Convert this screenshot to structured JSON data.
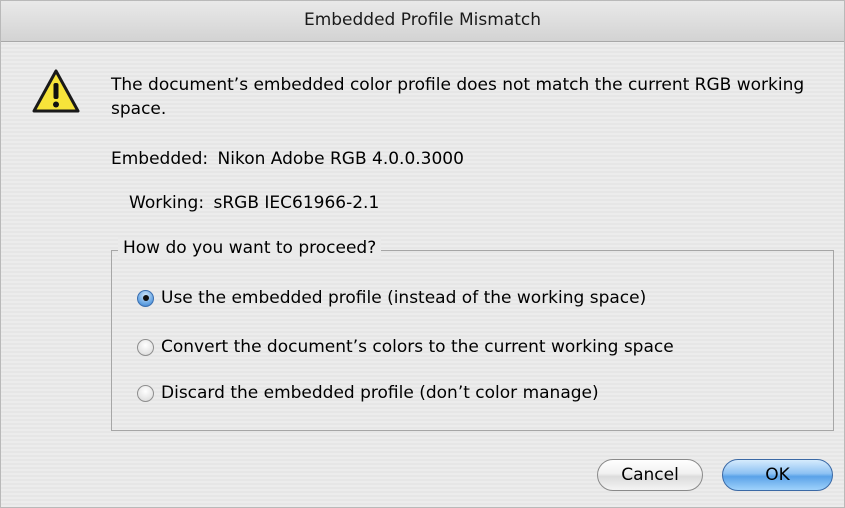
{
  "window": {
    "title": "Embedded Profile Mismatch"
  },
  "icons": {
    "warning": "warning-icon"
  },
  "message": "The document’s embedded color profile does not match the current RGB working space.",
  "embedded": {
    "label": "Embedded:",
    "value": "Nikon Adobe RGB 4.0.0.3000"
  },
  "working": {
    "label": "Working:",
    "value": "sRGB IEC61966-2.1"
  },
  "proceed_group": {
    "legend": "How do you want to proceed?",
    "options": [
      {
        "label": "Use the embedded profile (instead of the working space)",
        "selected": true
      },
      {
        "label": "Convert the document’s colors to the current working space",
        "selected": false
      },
      {
        "label": "Discard the embedded profile (don’t color manage)",
        "selected": false
      }
    ]
  },
  "buttons": {
    "cancel": "Cancel",
    "ok": "OK"
  },
  "colors": {
    "default_button": "#5aa2e8",
    "warning_yellow": "#f7e43a"
  }
}
